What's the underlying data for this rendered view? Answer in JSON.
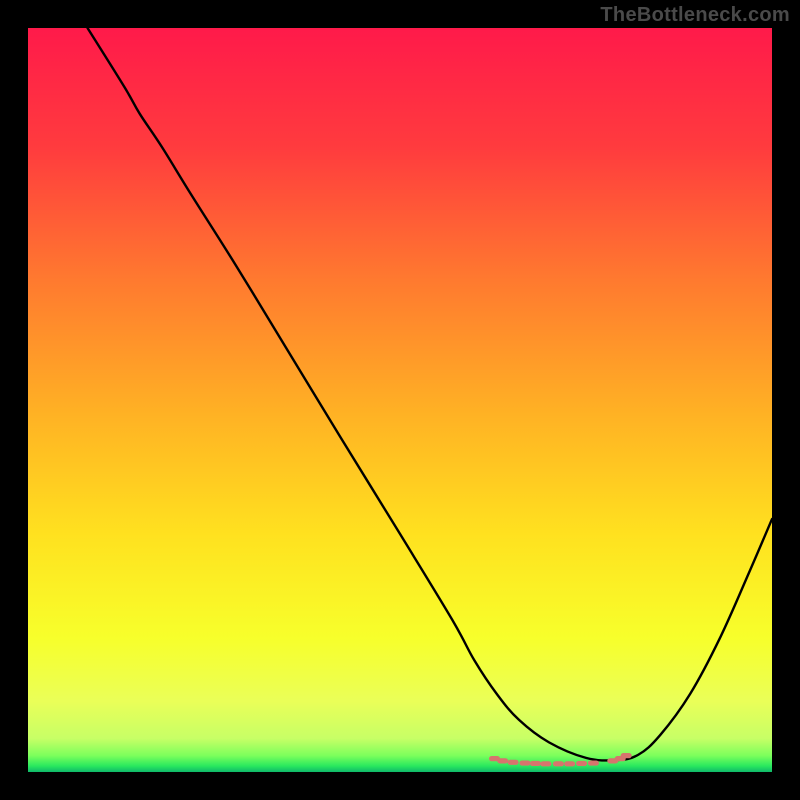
{
  "watermark": "TheBottleneck.com",
  "chart_data": {
    "type": "line",
    "title": "",
    "xlabel": "",
    "ylabel": "",
    "xlim": [
      0,
      100
    ],
    "ylim": [
      0,
      100
    ],
    "grid": false,
    "note": "No axes, ticks, or numeric labels are visible in the image; values below are estimated relative positions on a 0–100 canvas for reproduction.",
    "series": [
      {
        "name": "curve",
        "x": [
          8,
          13,
          15,
          18,
          22,
          28,
          35,
          42,
          50,
          57,
          60,
          63,
          66,
          70,
          75,
          79,
          82,
          85,
          89,
          93,
          97,
          100
        ],
        "y": [
          100,
          92,
          88.5,
          84,
          77.5,
          68,
          56.5,
          45,
          32,
          20.5,
          15,
          10.5,
          7,
          4,
          1.9,
          1.6,
          2.3,
          5,
          10.5,
          18,
          27,
          34
        ]
      }
    ],
    "markers": {
      "name": "dotted-cluster",
      "x": [
        62.7,
        63.8,
        65.2,
        66.8,
        68.2,
        69.6,
        71.3,
        72.8,
        74.4,
        76.0,
        78.6,
        79.6,
        80.4
      ],
      "y": [
        1.8,
        1.5,
        1.3,
        1.2,
        1.15,
        1.1,
        1.1,
        1.1,
        1.15,
        1.2,
        1.5,
        1.8,
        2.2
      ]
    },
    "background_gradient": {
      "type": "linear-vertical",
      "stops": [
        {
          "offset": 0.0,
          "color": "#ff1a4a"
        },
        {
          "offset": 0.16,
          "color": "#ff3b3e"
        },
        {
          "offset": 0.34,
          "color": "#ff7a2f"
        },
        {
          "offset": 0.52,
          "color": "#ffb224"
        },
        {
          "offset": 0.68,
          "color": "#ffe11f"
        },
        {
          "offset": 0.82,
          "color": "#f7ff2b"
        },
        {
          "offset": 0.905,
          "color": "#eaff58"
        },
        {
          "offset": 0.955,
          "color": "#c7ff66"
        },
        {
          "offset": 0.978,
          "color": "#7cff5c"
        },
        {
          "offset": 0.992,
          "color": "#29e85e"
        },
        {
          "offset": 1.0,
          "color": "#0fb86a"
        }
      ]
    }
  }
}
